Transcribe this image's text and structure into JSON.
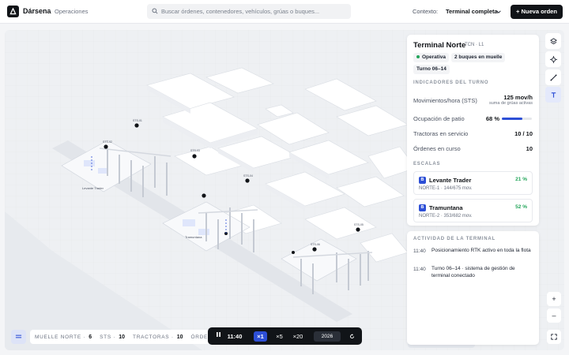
{
  "header": {
    "brand": "Dársena",
    "section": "Operaciones",
    "search_placeholder": "Buscar órdenes, contenedores, vehículos, grúas o buques...",
    "context_label": "Contexto:",
    "context_value": "Terminal completa",
    "new_order_label": "+ Nueva orden"
  },
  "panel": {
    "title": "Terminal Norte",
    "code": "TCN · L1",
    "status": "Operativa",
    "ships": "2 buques en muelle",
    "shift": "Turno 06–14",
    "indicators_title": "INDICADORES DEL TURNO",
    "indicators": [
      {
        "label": "Movimientos/hora (STS)",
        "value": "125 mov/h",
        "sub": "suma de grúas activas"
      },
      {
        "label": "Ocupación de patio",
        "value": "68 %",
        "fill": 0.68
      },
      {
        "label": "Tractoras en servicio",
        "value": "10 / 10"
      },
      {
        "label": "Órdenes en curso",
        "value": "10"
      }
    ],
    "cranes_title": "ESCALAS",
    "cranes": [
      {
        "badge": "B",
        "name": "Levante Trader",
        "pct": "21 %",
        "sub": "NORTE-1 · 144/675 mov."
      },
      {
        "badge": "B",
        "name": "Tramuntana",
        "pct": "52 %",
        "sub": "NORTE-2 · 353/682 mov."
      }
    ]
  },
  "activity": {
    "title": "ACTIVIDAD DE LA TERMINAL",
    "items": [
      {
        "time": "11:40",
        "text": "Posicionamiento RTK activo en toda la flota"
      },
      {
        "time": "11:40",
        "text": "Turno 06–14 · sistema de gestión de terminal conectado"
      }
    ]
  },
  "map": {
    "ship_labels": [
      "Levante Trader",
      "Tramuntana"
    ],
    "crane_labels": [
      "STS-01",
      "STS-02",
      "STS-03",
      "STS-04",
      "STS-05",
      "STS-06"
    ]
  },
  "stats": [
    {
      "label": "MUELLE NORTE ·",
      "value": "6"
    },
    {
      "label": "STS ·",
      "value": "10"
    },
    {
      "label": "TRACTORAS ·",
      "value": "10"
    },
    {
      "label": "ÓRDENES ·",
      "value": ""
    }
  ],
  "sim": {
    "time": "11:40",
    "speeds": [
      "×1",
      "×5",
      "×20"
    ],
    "year": "2026"
  },
  "zoom": {
    "in": "+",
    "out": "–"
  },
  "colors": {
    "accent": "#2d4fd6",
    "ok": "#23a55a",
    "dark": "#111418"
  }
}
